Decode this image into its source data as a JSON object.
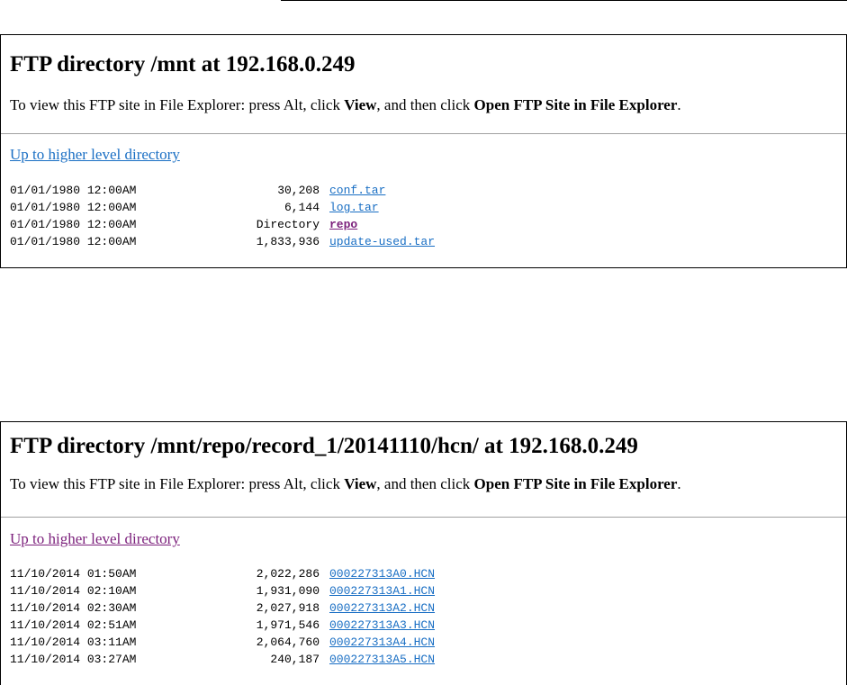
{
  "panels": [
    {
      "title": "FTP directory /mnt at 192.168.0.249",
      "intro_prefix": "To view this FTP site in File Explorer: press Alt, click ",
      "intro_view": "View",
      "intro_middle": ", and then click ",
      "intro_open": "Open FTP Site in File Explorer",
      "intro_suffix": ".",
      "up_link": "Up to higher level directory",
      "entries": [
        {
          "datetime": "01/01/1980 12:00AM",
          "size": "30,208",
          "name": "conf.tar"
        },
        {
          "datetime": "01/01/1980 12:00AM",
          "size": "6,144",
          "name": "log.tar"
        },
        {
          "datetime": "01/01/1980 12:00AM",
          "size": "Directory",
          "name": "repo"
        },
        {
          "datetime": "01/01/1980 12:00AM",
          "size": "1,833,936",
          "name": "update-used.tar"
        }
      ]
    },
    {
      "title": "FTP directory /mnt/repo/record_1/20141110/hcn/ at 192.168.0.249",
      "intro_prefix": "To view this FTP site in File Explorer: press Alt, click ",
      "intro_view": "View",
      "intro_middle": ", and then click ",
      "intro_open": "Open FTP Site in File Explorer",
      "intro_suffix": ".",
      "up_link": "Up to higher level directory",
      "entries": [
        {
          "datetime": "11/10/2014 01:50AM",
          "size": "2,022,286",
          "name": "000227313A0.HCN"
        },
        {
          "datetime": "11/10/2014 02:10AM",
          "size": "1,931,090",
          "name": "000227313A1.HCN"
        },
        {
          "datetime": "11/10/2014 02:30AM",
          "size": "2,027,918",
          "name": "000227313A2.HCN"
        },
        {
          "datetime": "11/10/2014 02:51AM",
          "size": "1,971,546",
          "name": "000227313A3.HCN"
        },
        {
          "datetime": "11/10/2014 03:11AM",
          "size": "2,064,760",
          "name": "000227313A4.HCN"
        },
        {
          "datetime": "11/10/2014 03:27AM",
          "size": "240,187",
          "name": "000227313A5.HCN"
        }
      ]
    }
  ],
  "colors": {
    "link": "#1a6fc4",
    "visited_link": "#7b1f7b",
    "text": "#000000",
    "divider": "#a0a0a0"
  }
}
